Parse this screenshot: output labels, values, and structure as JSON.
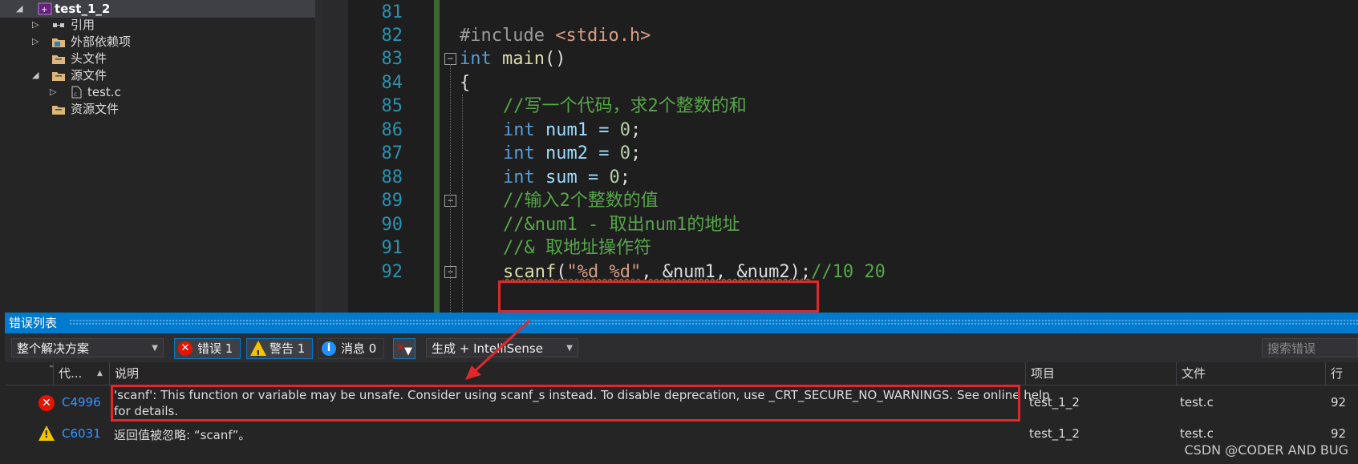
{
  "solution_explorer": {
    "project": "test_1_2",
    "items": [
      {
        "label": "引用",
        "icon": "references-icon"
      },
      {
        "label": "外部依赖项",
        "icon": "external-deps-icon"
      },
      {
        "label": "头文件",
        "icon": "folder-icon"
      },
      {
        "label": "源文件",
        "icon": "folder-icon"
      },
      {
        "label": "test.c",
        "icon": "c-file-icon"
      },
      {
        "label": "资源文件",
        "icon": "folder-icon"
      }
    ]
  },
  "editor": {
    "line_numbers": [
      "81",
      "82",
      "83",
      "84",
      "85",
      "86",
      "87",
      "88",
      "89",
      "90",
      "91",
      "92"
    ],
    "lines": {
      "l82_pp": "#include ",
      "l82_hdr": "<stdio.h>",
      "l83_kw": "int",
      "l83_fn": " main",
      "l83_rest": "()",
      "l84": "{",
      "l85": "//写一个代码，求2个整数的和",
      "l86_kw": "int",
      "l86_rest": " num1 = ",
      "l86_num": "0",
      "l86_end": ";",
      "l87_kw": "int",
      "l87_rest": " num2 = ",
      "l87_num": "0",
      "l87_end": ";",
      "l88_kw": "int",
      "l88_rest": " sum = ",
      "l88_num": "0",
      "l88_end": ";",
      "l89": "//输入2个整数的值",
      "l90": "//&num1 - 取出num1的地址",
      "l91": "//& 取地址操作符",
      "l92_fn": "scanf",
      "l92_open": "(",
      "l92_str": "\"%d %d\"",
      "l92_args": ", &num1, &num2);",
      "l92_cm": "//10 20"
    }
  },
  "error_list": {
    "title": "错误列表",
    "scope": "整个解决方案",
    "errors_btn": "错误 1",
    "warnings_btn": "警告 1",
    "messages_btn": "消息 0",
    "source": "生成 + IntelliSense",
    "search_placeholder": "搜索错误",
    "columns": {
      "code": "代...",
      "description": "说明",
      "project": "项目",
      "file": "文件",
      "line": "行"
    },
    "rows": [
      {
        "severity": "error",
        "code": "C4996",
        "description_1": "'scanf': This function or variable may be unsafe. Consider using scanf_s instead. To disable deprecation, use _CRT_SECURE_NO_WARNINGS. See online help",
        "description_2": "for details.",
        "project": "test_1_2",
        "file": "test.c",
        "line": "92"
      },
      {
        "severity": "warning",
        "code": "C6031",
        "description_1": "返回值被忽略: “scanf”。",
        "project": "test_1_2",
        "file": "test.c",
        "line": "92"
      }
    ]
  },
  "watermark": "CSDN @CODER AND BUG",
  "colors": {
    "accent": "#007acc",
    "highlight_box": "#e0282c",
    "error": "#e51400",
    "warning": "#f5c400"
  }
}
